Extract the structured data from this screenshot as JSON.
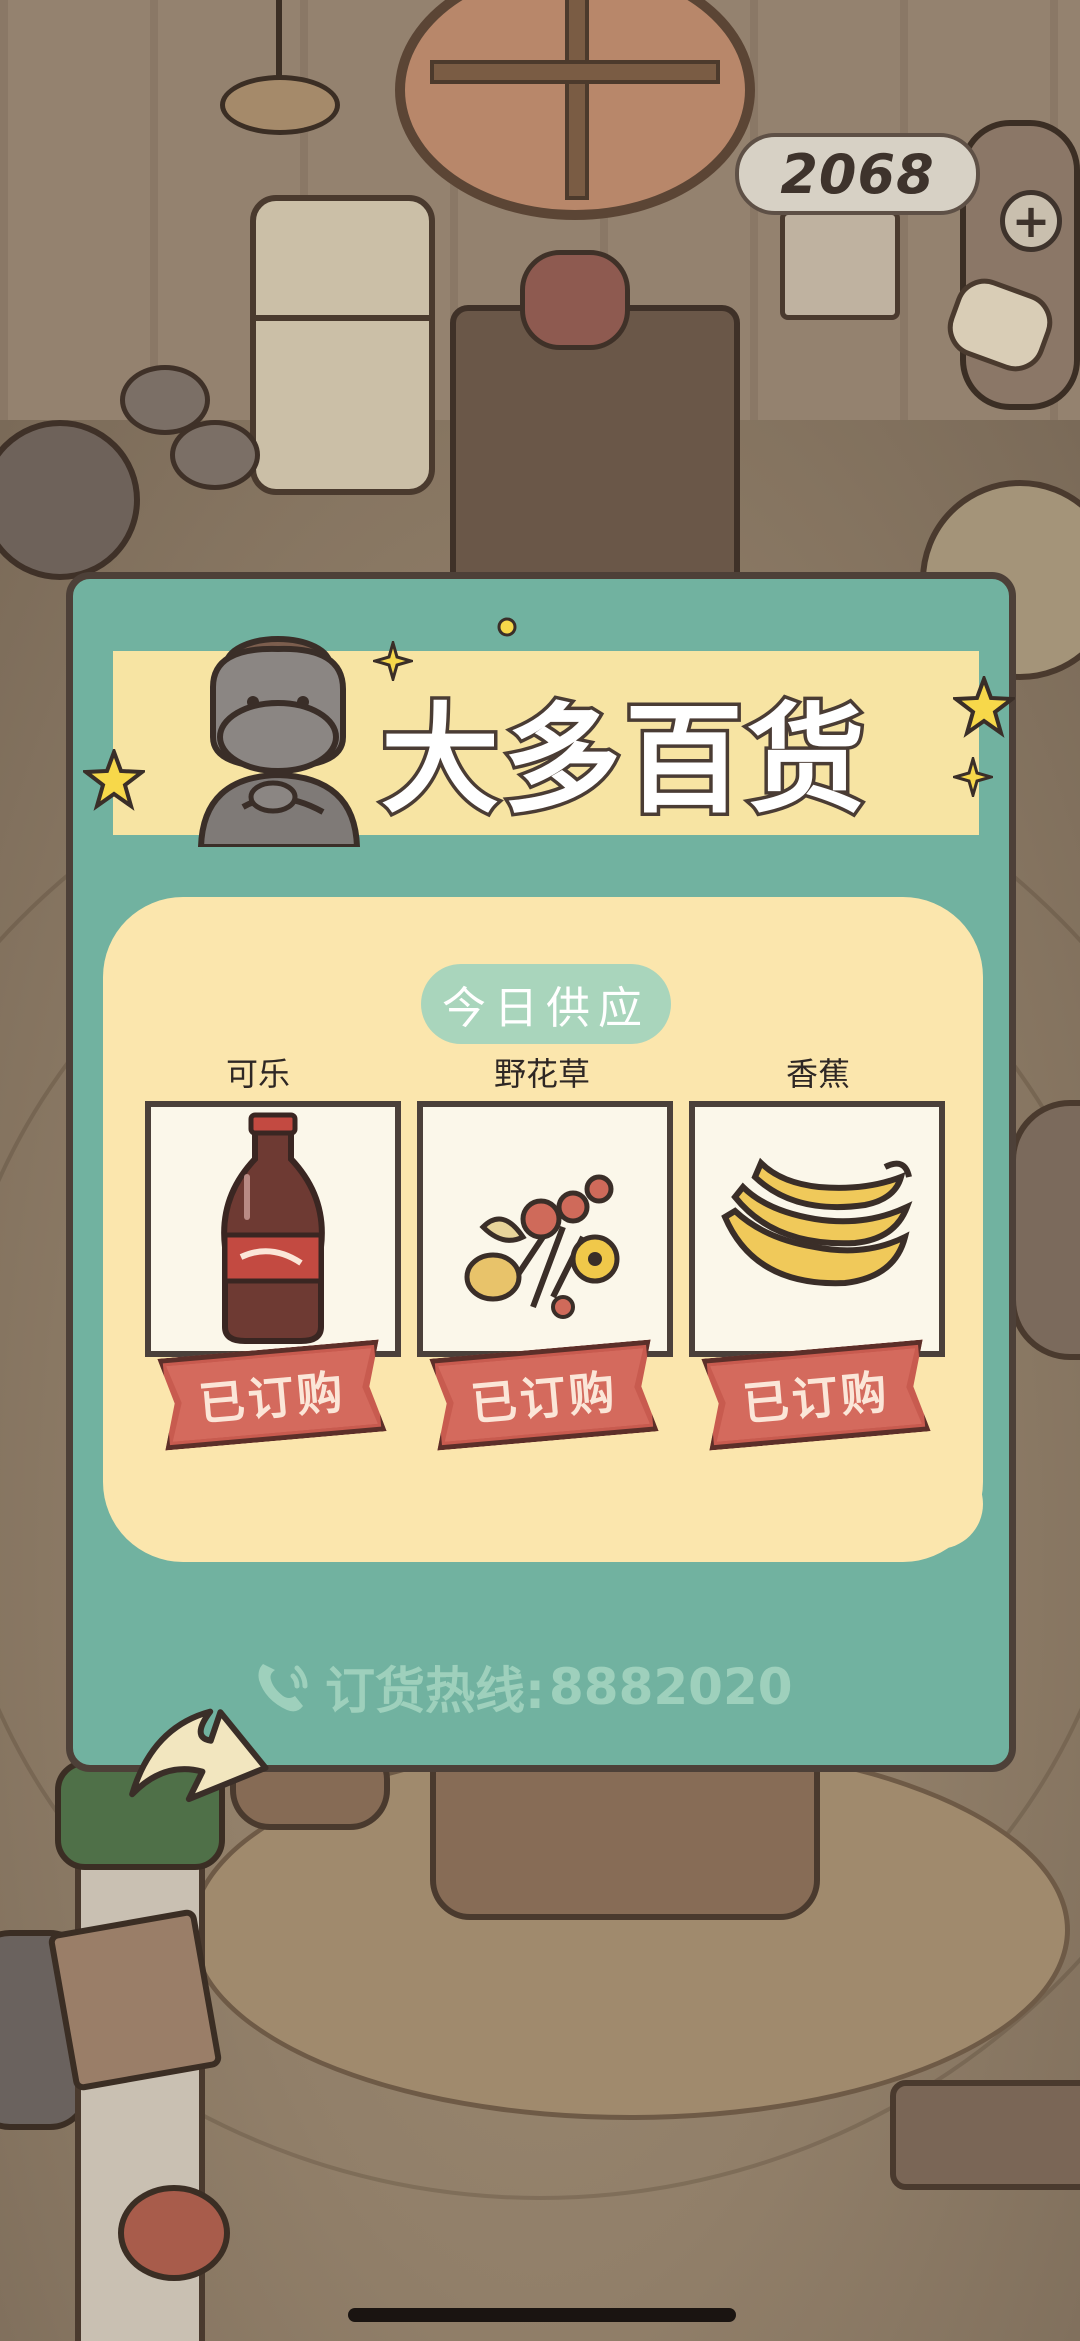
{
  "hud": {
    "coins": "2068",
    "add_coin_symbol": "+"
  },
  "shop": {
    "title": "大多百货",
    "section_label": "今日供应",
    "items": [
      {
        "name": "可乐",
        "status": "已订购",
        "icon": "cola-bottle-icon"
      },
      {
        "name": "野花草",
        "status": "已订购",
        "icon": "wildflower-bouquet-icon"
      },
      {
        "name": "香蕉",
        "status": "已订购",
        "icon": "banana-bunch-icon"
      }
    ],
    "hotline_label": "订货热线:",
    "hotline_number": "8882020"
  },
  "colors": {
    "card_green": "#71b2a0",
    "banner_yellow": "#f7e4a3",
    "panel_cream": "#fbe6ad",
    "tag_red": "#c85b4f",
    "outline": "#4d4038"
  }
}
